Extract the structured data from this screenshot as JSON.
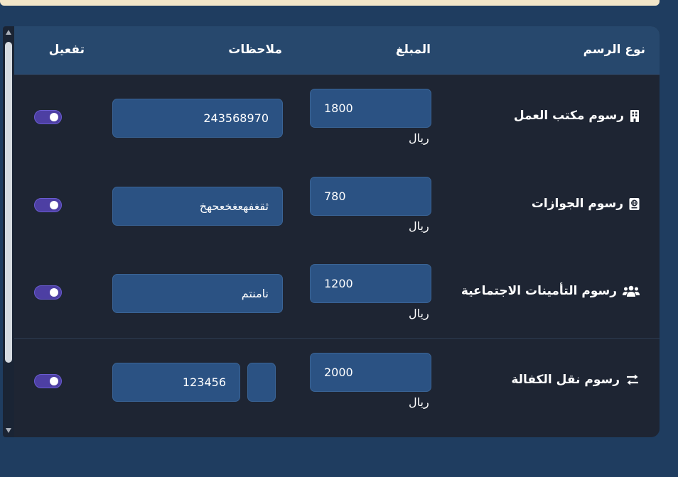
{
  "table": {
    "headers": {
      "fee_type": "نوع الرسم",
      "amount": "المبلغ",
      "notes": "ملاحظات",
      "activate": "تفعيل"
    },
    "currency": "ريال",
    "rows": [
      {
        "label": "رسوم مكتب العمل",
        "icon": "building-icon",
        "amount": "1800",
        "notes": "243568970",
        "enabled": true
      },
      {
        "label": "رسوم الجوازات",
        "icon": "passport-icon",
        "amount": "780",
        "notes": "ثقغفهعغخعحهخ",
        "enabled": true
      },
      {
        "label": "رسوم التأمينات الاجتماعية",
        "icon": "users-icon",
        "amount": "1200",
        "notes": "نامنتم",
        "enabled": true
      },
      {
        "label": "رسوم نقل الكفالة",
        "icon": "exchange-arrows-icon",
        "amount": "2000",
        "notes": "123456",
        "extra_notes": "",
        "enabled": true
      }
    ]
  },
  "colors": {
    "page_background": "#1f3d60",
    "panel_background": "#1e2533",
    "header_background": "#27486d",
    "input_background": "#2b5283",
    "toggle_on": "#4d3fa3",
    "top_banner": "#f2e6c9"
  }
}
